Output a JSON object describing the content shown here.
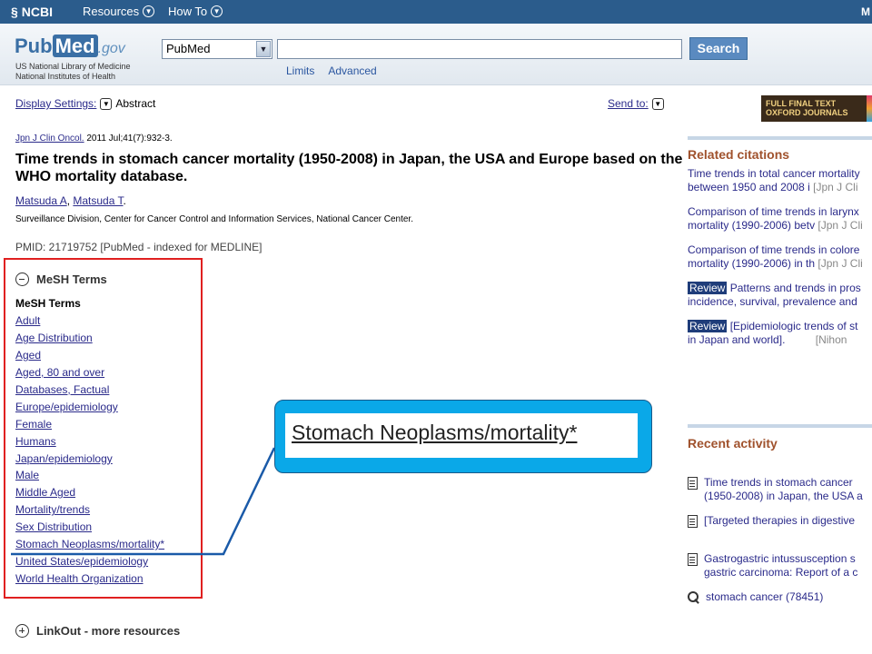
{
  "topbar": {
    "logo": "NCBI",
    "resources": "Resources",
    "howto": "How To",
    "right": "M"
  },
  "header": {
    "logo_pub": "Pub",
    "logo_med": "Med",
    "logo_gov": ".gov",
    "library_line1": "US National Library of Medicine",
    "library_line2": "National Institutes of Health",
    "database": "PubMed",
    "search_value": "",
    "search_button": "Search",
    "limits": "Limits",
    "advanced": "Advanced"
  },
  "display": {
    "settings_label": "Display Settings:",
    "format": "Abstract",
    "send_to": "Send to:"
  },
  "article": {
    "journal": "Jpn J Clin Oncol.",
    "citation": " 2011 Jul;41(7):932-3.",
    "title": "Time trends in stomach cancer mortality (1950-2008) in Japan, the USA and Europe based on the WHO mortality database.",
    "author1": "Matsuda A",
    "author2": "Matsuda T",
    "affiliation": "Surveillance Division, Center for Cancer Control and Information Services, National Cancer Center.",
    "pmid": "PMID: 21719752 [PubMed - indexed for MEDLINE]"
  },
  "mesh": {
    "section_title": "MeSH Terms",
    "subtitle": "MeSH Terms",
    "terms": [
      "Adult",
      "Age Distribution",
      "Aged",
      "Aged, 80 and over",
      "Databases, Factual",
      "Europe/epidemiology",
      "Female",
      "Humans",
      "Japan/epidemiology",
      "Male",
      "Middle Aged",
      "Mortality/trends",
      "Sex Distribution",
      "Stomach Neoplasms/mortality*",
      "United States/epidemiology",
      "World Health Organization"
    ]
  },
  "linkout": "LinkOut - more resources",
  "callout": {
    "text": "Stomach Neoplasms/mortality*"
  },
  "ad": {
    "line1": "FULL FINAL TEXT",
    "line2": "OXFORD JOURNALS"
  },
  "related": {
    "title": "Related citations",
    "items": [
      {
        "line1": "Time trends in total cancer mortality",
        "line2": "between 1950 and 2008 i",
        "src": "[Jpn J Cli"
      },
      {
        "line1": "Comparison of time trends in larynx",
        "line2": "mortality (1990-2006) betv",
        "src": "[Jpn J Cli"
      },
      {
        "line1": "Comparison of time trends in colore",
        "line2": "mortality (1990-2006) in th",
        "src": "[Jpn J Cli"
      },
      {
        "badge": "Review",
        "line1": " Patterns and trends in pros",
        "line2": "incidence, survival, prevalence and",
        "src": ""
      },
      {
        "badge": "Review",
        "line1": " [Epidemiologic trends of st",
        "line2": "in Japan and world].",
        "src": "[Nihon"
      }
    ]
  },
  "recent": {
    "title": "Recent activity",
    "items": [
      {
        "line1": "Time trends in stomach cancer",
        "line2": "(1950-2008) in Japan, the USA a"
      },
      {
        "line1": "[Targeted therapies in digestive",
        "line2": ""
      },
      {
        "line1": "Gastrogastric intussusception s",
        "line2": "gastric carcinoma: Report of a c"
      },
      {
        "line1": "stomach cancer (78451)",
        "line2": ""
      }
    ]
  },
  "colors": {
    "topbar": "#2b5c8c",
    "accent_red": "#e02020",
    "callout_blue": "#0aa8e8",
    "link": "#2a2a8a",
    "section_title": "#a0522d"
  }
}
